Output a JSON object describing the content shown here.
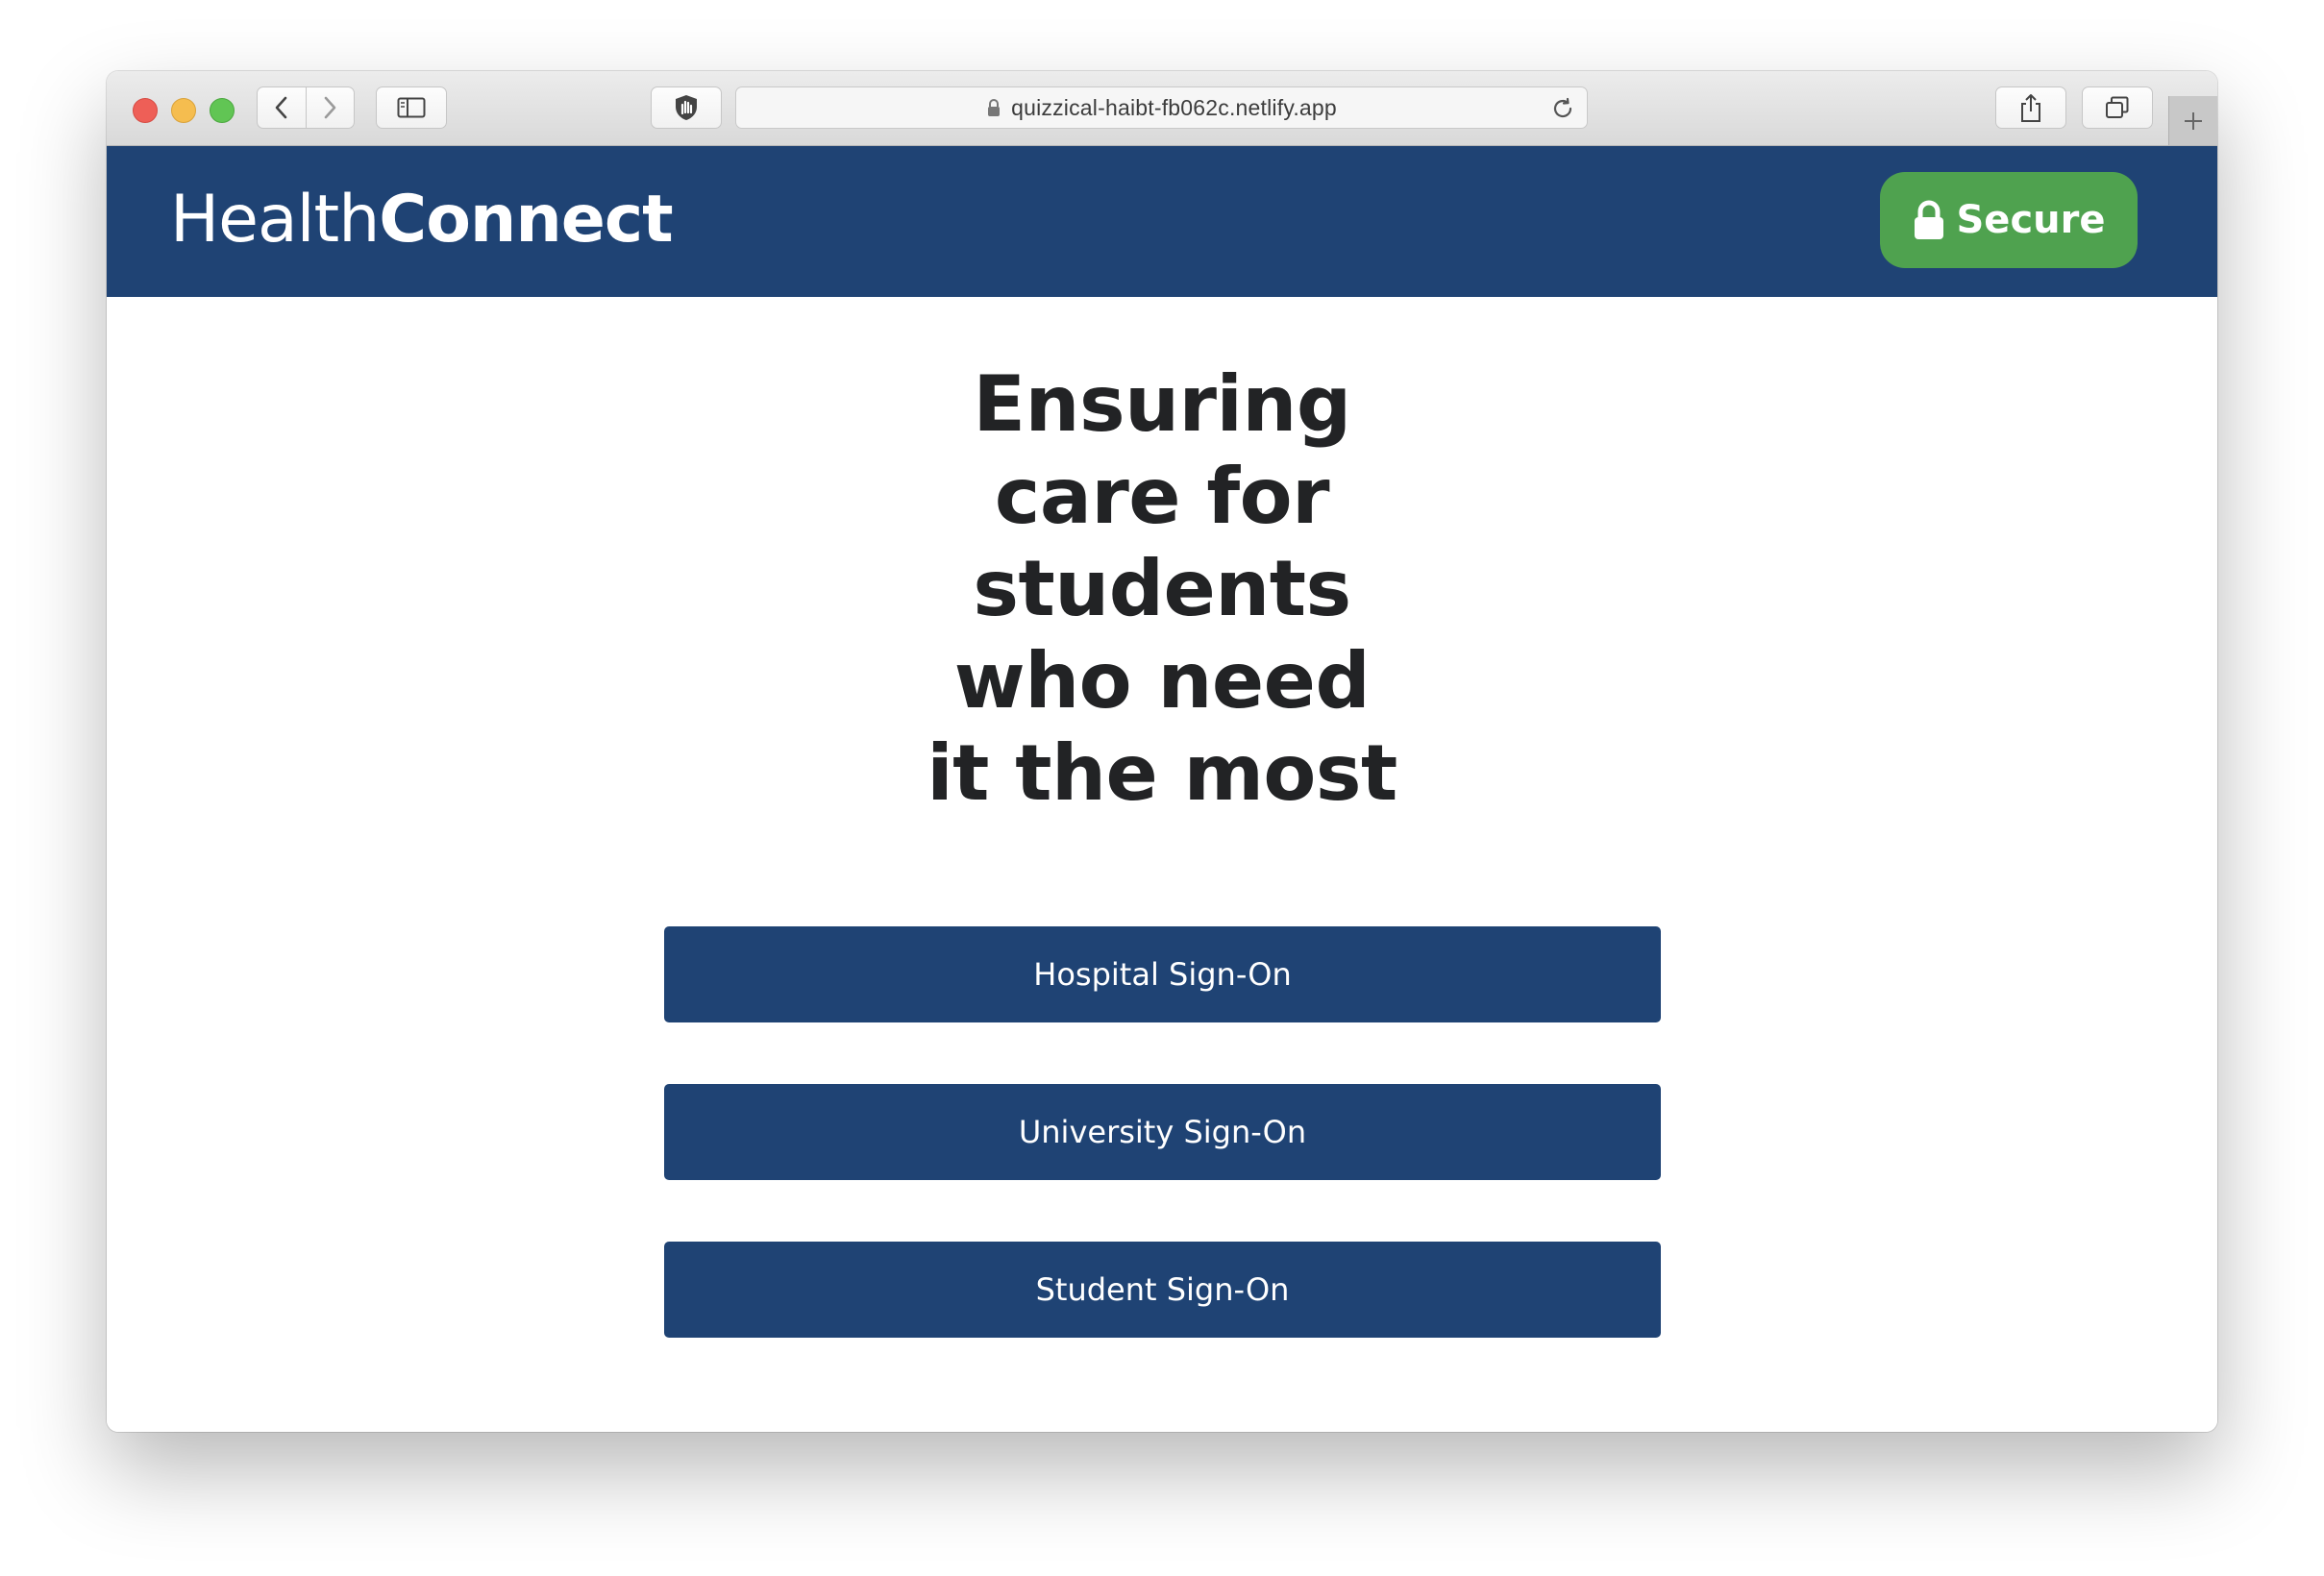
{
  "browser": {
    "url": "quizzical-haibt-fb062c.netlify.app",
    "icons": {
      "back": "chevron-left-icon",
      "forward": "chevron-right-icon",
      "sidebar": "sidebar-icon",
      "privacy": "hand-shield-icon",
      "lock": "lock-icon",
      "reload": "reload-icon",
      "share": "share-icon",
      "tabs": "tabs-icon",
      "new_tab": "plus-icon"
    }
  },
  "header": {
    "brand_light": "Health",
    "brand_bold": "Connect",
    "secure_label": "Secure",
    "background_color": "#1f4374",
    "secure_color": "#4fa24f"
  },
  "hero": {
    "headline_lines": [
      "Ensuring",
      "care for",
      "students",
      "who need",
      "it the most"
    ]
  },
  "signon": {
    "buttons": [
      "Hospital Sign-On",
      "University Sign-On",
      "Student Sign-On"
    ],
    "button_color": "#1f4374"
  }
}
